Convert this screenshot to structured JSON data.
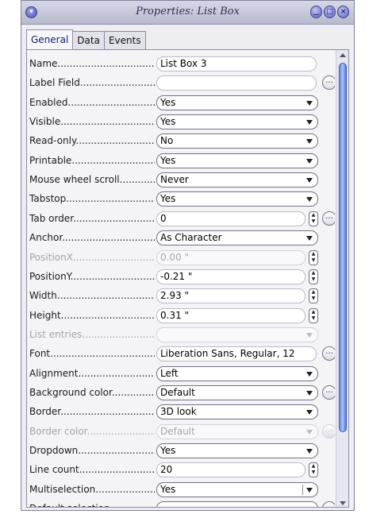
{
  "window": {
    "title": "Properties: List Box",
    "menu_icon": "chevron-down-icon",
    "buttons": [
      "minimize-icon",
      "maximize-icon",
      "close-icon"
    ]
  },
  "tabs": [
    {
      "label": "General",
      "active": true
    },
    {
      "label": "Data",
      "active": false
    },
    {
      "label": "Events",
      "active": false
    }
  ],
  "properties": [
    {
      "label": "Name",
      "type": "text",
      "value": "List Box 3"
    },
    {
      "label": "Label Field",
      "type": "text",
      "value": "",
      "ellipsis": true
    },
    {
      "label": "Enabled",
      "type": "dropdown",
      "value": "Yes"
    },
    {
      "label": "Visible",
      "type": "dropdown",
      "value": "Yes"
    },
    {
      "label": "Read-only",
      "type": "dropdown",
      "value": "No"
    },
    {
      "label": "Printable",
      "type": "dropdown",
      "value": "Yes"
    },
    {
      "label": "Mouse wheel scroll",
      "type": "dropdown",
      "value": "Never"
    },
    {
      "label": "Tabstop",
      "type": "dropdown",
      "value": "Yes"
    },
    {
      "label": "Tab order",
      "type": "spin",
      "value": "0",
      "ellipsis": true
    },
    {
      "label": "Anchor",
      "type": "dropdown",
      "value": "As Character"
    },
    {
      "label": "PositionX",
      "type": "spin",
      "value": "0.00 \"",
      "disabled": true
    },
    {
      "label": "PositionY",
      "type": "spin",
      "value": "-0.21 \""
    },
    {
      "label": "Width",
      "type": "spin",
      "value": "2.93 \""
    },
    {
      "label": "Height",
      "type": "spin",
      "value": "0.31 \""
    },
    {
      "label": "List entries",
      "type": "dropdown",
      "value": "",
      "disabled": true
    },
    {
      "label": "Font",
      "type": "text",
      "value": "Liberation Sans, Regular, 12",
      "ellipsis": true
    },
    {
      "label": "Alignment",
      "type": "dropdown",
      "value": "Left"
    },
    {
      "label": "Background color",
      "type": "dropdown",
      "value": "Default",
      "ellipsis": true
    },
    {
      "label": "Border",
      "type": "dropdown",
      "value": "3D look"
    },
    {
      "label": "Border color",
      "type": "dropdown",
      "value": "Default",
      "disabled": true,
      "ellipsis": true
    },
    {
      "label": "Dropdown",
      "type": "dropdown",
      "value": "Yes"
    },
    {
      "label": "Line count",
      "type": "spin",
      "value": "20"
    },
    {
      "label": "Multiselection",
      "type": "dropdown",
      "value": "Yes",
      "divider": true
    },
    {
      "label": "Default selection",
      "type": "dropdown",
      "value": "",
      "ellipsis": true
    }
  ]
}
